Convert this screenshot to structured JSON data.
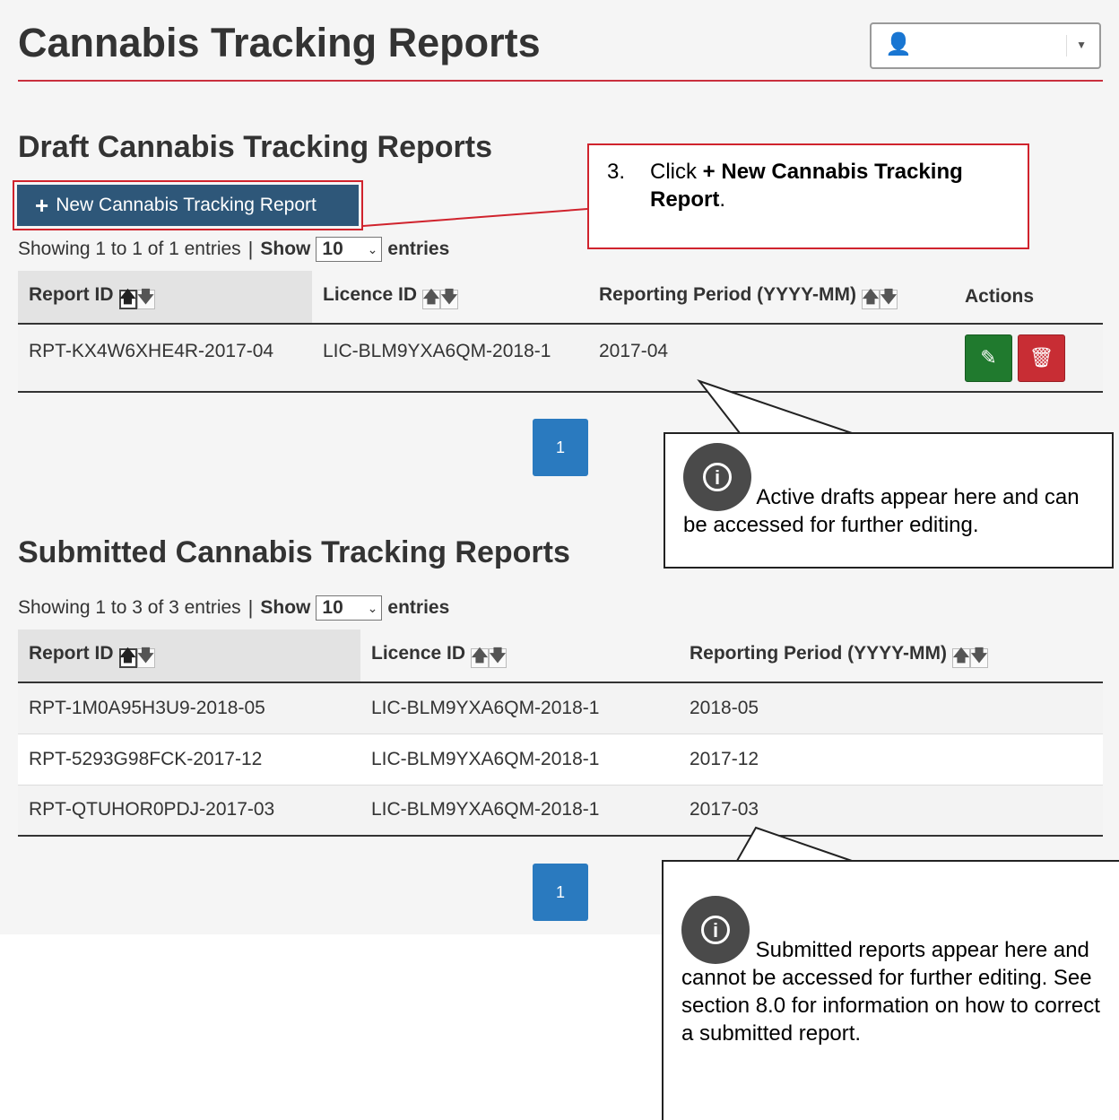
{
  "header": {
    "title": "Cannabis Tracking Reports",
    "user_icon": "user-icon"
  },
  "drafts": {
    "heading": "Draft Cannabis Tracking Reports",
    "new_button": {
      "icon": "+",
      "label": "New Cannabis Tracking Report"
    },
    "showing": "Showing 1 to 1 of 1 entries",
    "show_label": "Show",
    "page_size": "10",
    "entries_label": "entries",
    "columns": [
      "Report ID",
      "Licence ID",
      "Reporting Period (YYYY-MM)",
      "Actions"
    ],
    "rows": [
      {
        "report_id": "RPT-KX4W6XHE4R-2017-04",
        "licence_id": "LIC-BLM9YXA6QM-2018-1",
        "period": "2017-04"
      }
    ],
    "page": "1"
  },
  "submitted": {
    "heading": "Submitted Cannabis Tracking Reports",
    "showing": "Showing 1 to 3 of 3 entries",
    "show_label": "Show",
    "page_size": "10",
    "entries_label": "entries",
    "columns": [
      "Report ID",
      "Licence ID",
      "Reporting Period (YYYY-MM)"
    ],
    "rows": [
      {
        "report_id": "RPT-1M0A95H3U9-2018-05",
        "licence_id": "LIC-BLM9YXA6QM-2018-1",
        "period": "2018-05"
      },
      {
        "report_id": "RPT-5293G98FCK-2017-12",
        "licence_id": "LIC-BLM9YXA6QM-2018-1",
        "period": "2017-12"
      },
      {
        "report_id": "RPT-QTUHOR0PDJ-2017-03",
        "licence_id": "LIC-BLM9YXA6QM-2018-1",
        "period": "2017-03"
      }
    ],
    "page": "1"
  },
  "callouts": {
    "step_number": "3.",
    "step_prefix": "Click ",
    "step_bold": "+ New Cannabis Tracking Report",
    "step_suffix": ".",
    "drafts_note": "Active drafts appear here and can be accessed for further editing.",
    "submitted_note": "Submitted reports appear here and cannot be accessed for further editing. See section 8.0 for information on how to correct a submitted report."
  },
  "colors": {
    "title_rule": "#c9303e",
    "primary_button": "#2e5779",
    "edit_button": "#207a2e",
    "delete_button": "#c82d34",
    "pagination": "#2a7abf"
  }
}
